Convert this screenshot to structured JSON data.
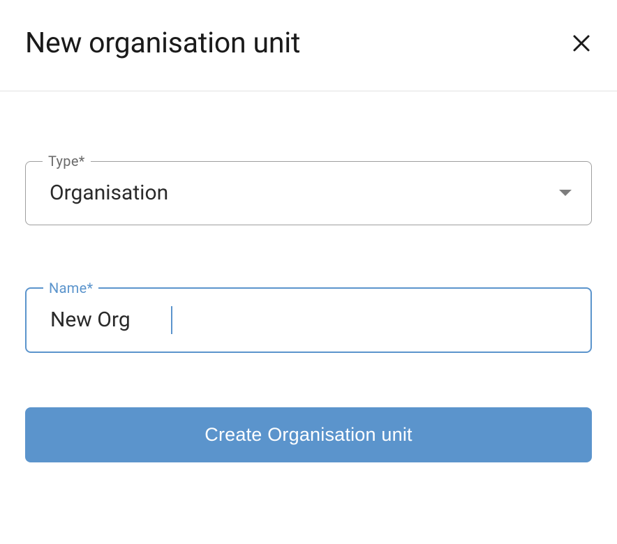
{
  "dialog": {
    "title": "New organisation unit"
  },
  "fields": {
    "type": {
      "label": "Type*",
      "value": "Organisation"
    },
    "name": {
      "label": "Name*",
      "value": "New Org"
    }
  },
  "actions": {
    "create_label": "Create Organisation unit"
  }
}
